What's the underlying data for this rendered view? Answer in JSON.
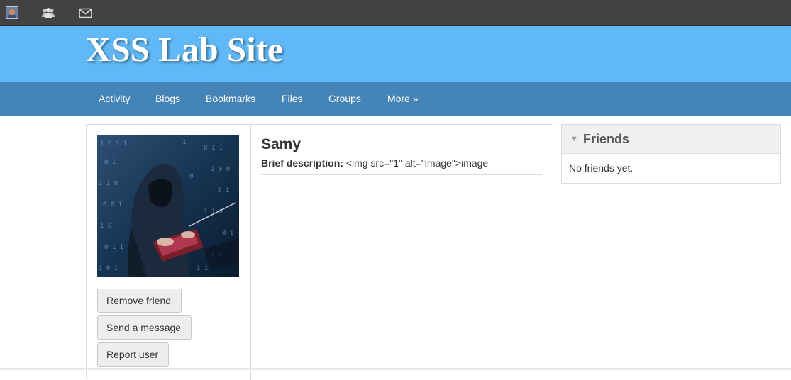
{
  "toolbar": {
    "icons": [
      "avatar-icon",
      "friends-icon",
      "mail-icon"
    ]
  },
  "header": {
    "site_title": "XSS Lab Site"
  },
  "nav": {
    "items": [
      "Activity",
      "Blogs",
      "Bookmarks",
      "Files",
      "Groups",
      "More »"
    ]
  },
  "profile": {
    "name": "Samy",
    "description_label": "Brief description:",
    "description_value": "<img src=\"1\" alt=\"image\">image",
    "buttons": {
      "remove_friend": "Remove friend",
      "send_message": "Send a message",
      "report_user": "Report user"
    }
  },
  "friends": {
    "title": "Friends",
    "empty_text": "No friends yet."
  },
  "colors": {
    "header_bg": "#60b8f6",
    "nav_bg": "#4584b7",
    "topbar_bg": "#424242"
  }
}
